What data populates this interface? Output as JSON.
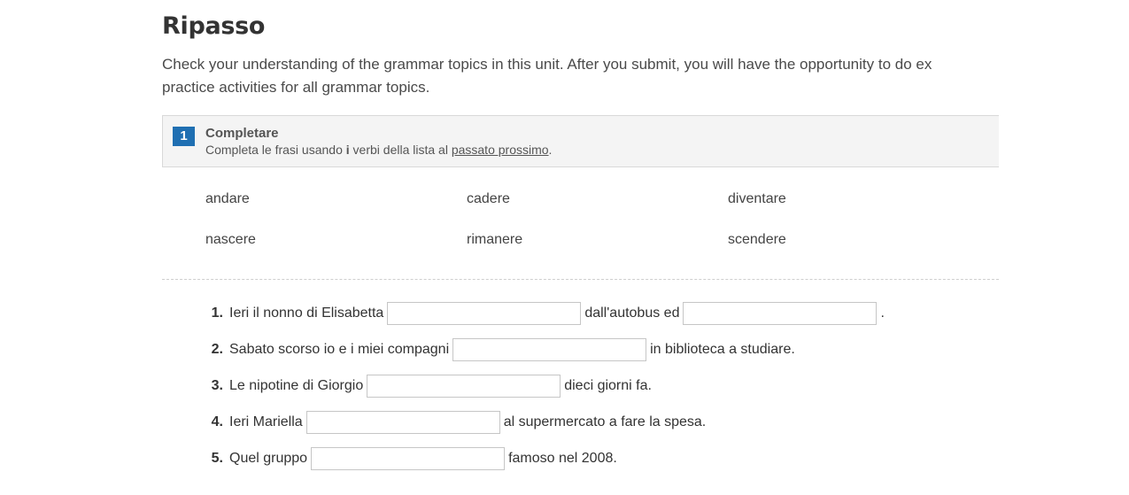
{
  "page": {
    "title": "Ripasso",
    "intro_line1": "Check your understanding of the grammar topics in this unit. After you submit, you will have the opportunity to do ex",
    "intro_line2": "practice activities for all grammar topics."
  },
  "activity": {
    "number": "1",
    "title": "Completare",
    "instructions": {
      "part1": "Completa le frasi usando ",
      "bold": "i",
      "part2": " verbi della lista al ",
      "link": "passato prossimo",
      "end": "."
    }
  },
  "word_bank": [
    "andare",
    "cadere",
    "diventare",
    "nascere",
    "rimanere",
    "scendere"
  ],
  "questions": [
    {
      "num": "1.",
      "before": "Ieri il nonno di Elisabetta",
      "middle": "dall'autobus ed",
      "after": ".",
      "blank1": "",
      "blank2": ""
    },
    {
      "num": "2.",
      "before": "Sabato scorso io e i miei compagni",
      "after": "in biblioteca a studiare.",
      "blank1": ""
    },
    {
      "num": "3.",
      "before": "Le nipotine di Giorgio",
      "after": "dieci giorni fa.",
      "blank1": ""
    },
    {
      "num": "4.",
      "before": "Ieri Mariella",
      "after": "al supermercato a fare la spesa.",
      "blank1": ""
    },
    {
      "num": "5.",
      "before": "Quel gruppo",
      "after": "famoso nel 2008.",
      "blank1": ""
    }
  ],
  "colors": {
    "accent": "#1f6fb2",
    "header_bg": "#f4f4f4",
    "text": "#333333"
  }
}
